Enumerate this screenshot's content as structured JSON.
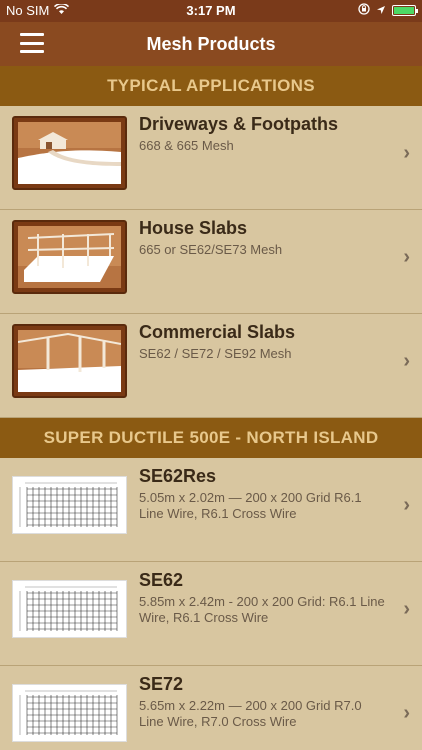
{
  "status": {
    "carrier": "No SIM",
    "time": "3:17 PM"
  },
  "nav": {
    "title": "Mesh Products"
  },
  "sections": [
    {
      "title": "TYPICAL APPLICATIONS"
    },
    {
      "title": "SUPER DUCTILE 500E - NORTH ISLAND"
    }
  ],
  "applications": [
    {
      "title": "Driveways & Footpaths",
      "subtitle": "668 & 665 Mesh"
    },
    {
      "title": "House Slabs",
      "subtitle": "665 or SE62/SE73 Mesh"
    },
    {
      "title": "Commercial Slabs",
      "subtitle": "SE62 / SE72 / SE92 Mesh"
    }
  ],
  "products": [
    {
      "title": "SE62Res",
      "subtitle": "5.05m x 2.02m — 200 x 200 Grid R6.1 Line Wire, R6.1 Cross Wire"
    },
    {
      "title": "SE62",
      "subtitle": "5.85m x 2.42m - 200 x 200 Grid: R6.1 Line Wire, R6.1 Cross Wire"
    },
    {
      "title": "SE72",
      "subtitle": "5.65m x 2.22m — 200 x 200 Grid R7.0 Line Wire, R7.0 Cross Wire"
    }
  ]
}
